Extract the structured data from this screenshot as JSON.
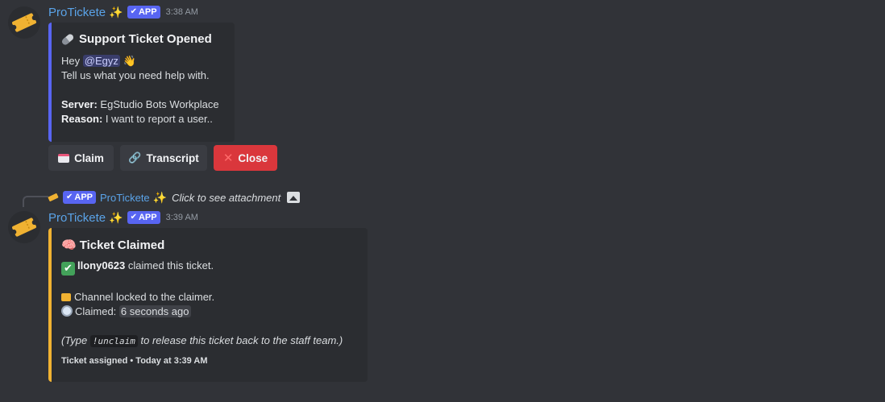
{
  "colors": {
    "accent_blue": "#5865f2",
    "accent_yellow": "#f0b232",
    "danger": "#da373c"
  },
  "msg1": {
    "username": "ProTickete",
    "badge": "APP",
    "time": "3:38 AM",
    "embed": {
      "title": "Support Ticket Opened",
      "greeting": "Hey",
      "mention": "@Egyz",
      "line2": "Tell us what you need help with.",
      "server_label": "Server:",
      "server_value": " EgStudio Bots Workplace",
      "reason_label": "Reason:",
      "reason_value": " I want to report a user.."
    },
    "buttons": {
      "claim": "Claim",
      "transcript": "Transcript",
      "close": "Close"
    }
  },
  "reply": {
    "badge": "APP",
    "username": "ProTickete",
    "text": "Click to see attachment"
  },
  "msg2": {
    "username": "ProTickete",
    "badge": "APP",
    "time": "3:39 AM",
    "embed": {
      "title": "Ticket Claimed",
      "claimer": "llony0623",
      "claimed_text": " claimed this ticket.",
      "locked_text": "Channel locked to the claimer.",
      "claimed_label": "Claimed:",
      "claimed_ago": "6 seconds ago",
      "note_pre": "(Type ",
      "note_code": "!unclaim",
      "note_post": " to release this ticket back to the staff team.)",
      "footer": "Ticket assigned • Today at 3:39 AM"
    }
  }
}
